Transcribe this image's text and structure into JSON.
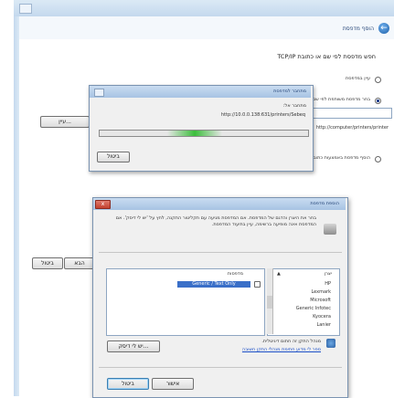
{
  "wizard": {
    "title": "הוסף מדפסת",
    "heading": "חפש מדפסת לפי שם או כתובת TCP/IP",
    "option_browse": "עיין במדפסת",
    "option_shared": "בחר מדפסת משותפת לפי שם",
    "option_shared_example": "http://computer/printers/printer",
    "option_tcpip": "הוסף מדפסת באמצעות כתובת TCP/IP או שם מארח",
    "browse_label": "עיין...",
    "cancel_label": "ביטול",
    "next_label": "הבא"
  },
  "progress_dialog": {
    "title": "מתחבר למדפסת",
    "connecting_label": "מתחבר אל:",
    "url": "http://10.0.0.138:631/printers/Sebeq",
    "cancel_label": "ביטול",
    "progress_note": "indeterminate"
  },
  "add_printer_dialog": {
    "title": "הוספת מדפסת",
    "instructions": "בחר את היצרן והדגם של המדפסת. אם המדפסת מגיעה עם תקליטור התקנה, לחץ על 'יש לי דיסק'. אם המדפסת אינה מופיעה ברשימה, עיין בתיעוד המדפסת.",
    "manufacturer_header": "יצרן",
    "manufacturers": [
      "HP",
      "Lexmark",
      "Microsoft",
      "Generic Infotec",
      "Kyocera",
      "Lanier"
    ],
    "printers_header": "מדפסות",
    "printers": [
      "Generic / Text Only"
    ],
    "signed_note": "מנהל התקן זה חתום דיגיטלית.",
    "signing_link": "ספר לי מדוע חתימת מנהלי התקן חשובה",
    "have_disk_label": "יש לי דיסק...",
    "ok_label": "אישור",
    "cancel_label": "ביטול"
  }
}
